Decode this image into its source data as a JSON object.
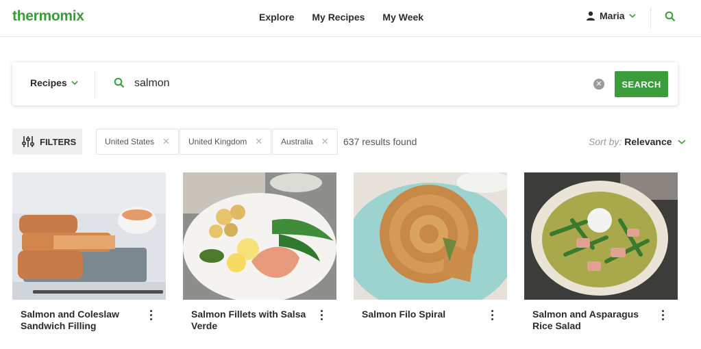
{
  "header": {
    "logo": "thermomix",
    "nav": [
      "Explore",
      "My Recipes",
      "My Week"
    ],
    "user_name": "Maria"
  },
  "search": {
    "category": "Recipes",
    "query": "salmon",
    "button_label": "SEARCH"
  },
  "filters": {
    "button_label": "FILTERS",
    "chips": [
      "United States",
      "United Kingdom",
      "Australia"
    ],
    "results_text": "637 results found",
    "sort_label": "Sort by:",
    "sort_value": "Relevance"
  },
  "recipes": [
    {
      "title": "Salmon and Coleslaw Sandwich Filling"
    },
    {
      "title": "Salmon Fillets with Salsa Verde"
    },
    {
      "title": "Salmon Filo Spiral"
    },
    {
      "title": "Salmon and Asparagus Rice Salad"
    }
  ],
  "colors": {
    "brand_green": "#3a9c3a"
  }
}
